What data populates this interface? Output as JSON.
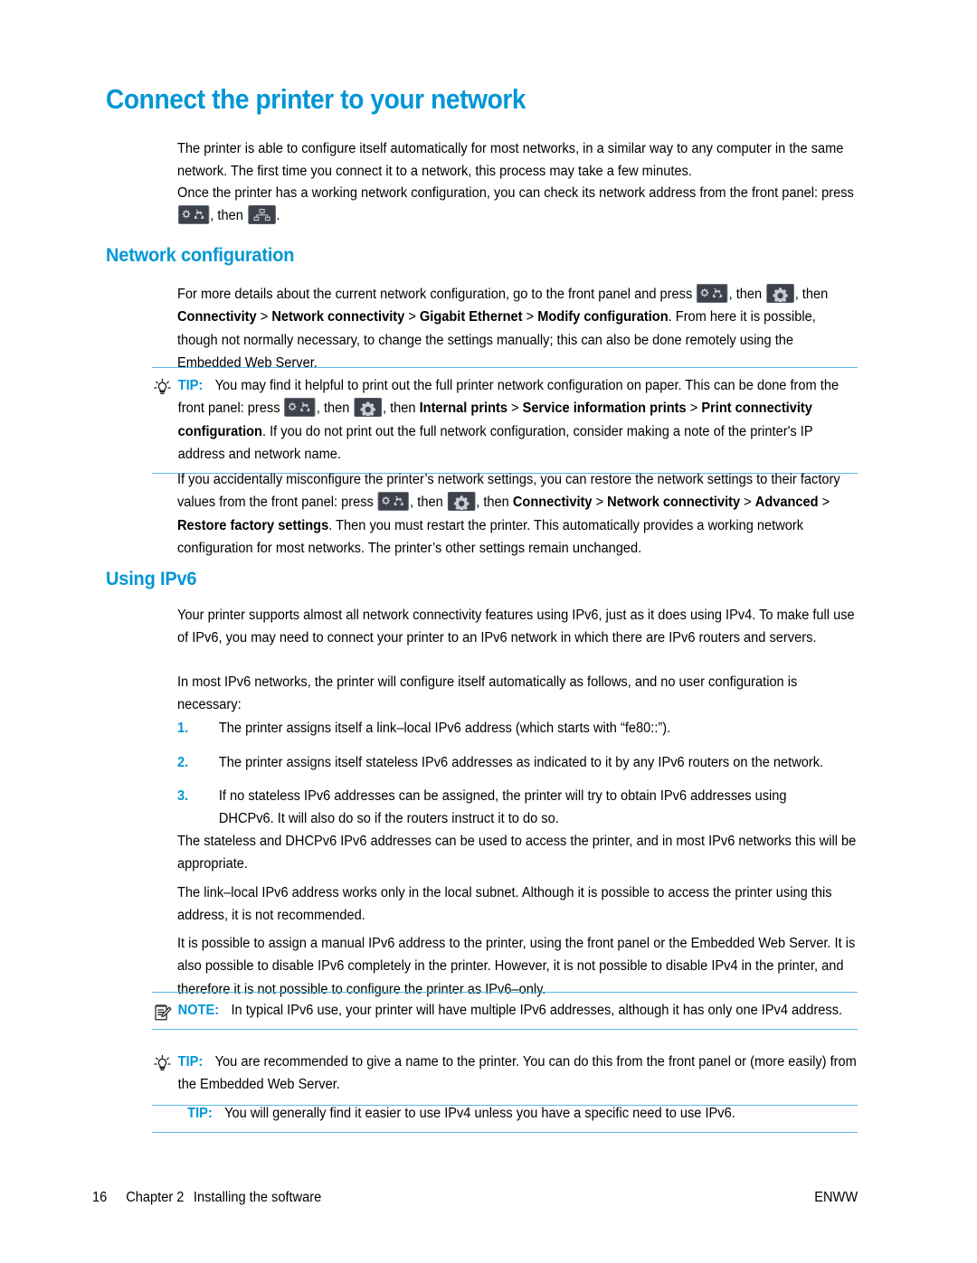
{
  "page": {
    "heading": "Connect the printer to your network",
    "accent_color": "#0096d6",
    "rule_color": "#5bb9e8"
  },
  "intro": {
    "para1": "The printer is able to configure itself automatically for most networks, in a similar way to any computer in the same network. The first time you connect it to a network, this process may take a few minutes.",
    "para2_a": "Once the printer has a working network configuration, you can check its network address from the front panel: press ",
    "para2_b": ", then ",
    "para2_c": "."
  },
  "network_configuration": {
    "heading": "Network configuration",
    "para_a": "For more details about the current network configuration, go to the front panel and press ",
    "para_b": ", then ",
    "para_c": ", then ",
    "bold1": "Connectivity",
    "sep1": " > ",
    "bold2": "Network connectivity",
    "sep2": " > ",
    "bold3": "Gigabit Ethernet",
    "sep3": " > ",
    "bold4": "Modify configuration",
    "para_d": ". From here it is possible, though not normally necessary, to change the settings manually; this can also be done remotely using the Embedded Web Server.",
    "tip": {
      "label": "TIP:",
      "icon": "lightbulb-icon",
      "text_a": "You may find it helpful to print out the full printer network configuration on paper. This can be done from the front panel: press ",
      "text_b": ", then ",
      "text_c": ", then ",
      "bold1": "Internal prints",
      "sep1": " > ",
      "bold2": "Service information prints",
      "sep2": " > ",
      "bold3": "Print connectivity configuration",
      "text_d": ". If you do not print out the full network configuration, consider making a note of the printer's IP address and network name."
    },
    "restore_a": "If you accidentally misconfigure the printer’s network settings, you can restore the network settings to their factory values from the front panel: press ",
    "restore_b": ", then ",
    "restore_c": ", then ",
    "restore_bold1": "Connectivity",
    "restore_sep1": " > ",
    "restore_bold2": "Network connectivity",
    "restore_sep2": " > ",
    "restore_bold3": "Advanced",
    "restore_sep3": " > ",
    "restore_bold4": "Restore factory settings",
    "restore_d": ". Then you must restart the printer. This automatically provides a working network configuration for most networks. The printer’s other settings remain unchanged."
  },
  "using_ipv6": {
    "heading": "Using IPv6",
    "para1": "Your printer supports almost all network connectivity features using IPv6, just as it does using IPv4. To make full use of IPv6, you may need to connect your printer to an IPv6 network in which there are IPv6 routers and servers.",
    "para2": "In most IPv6 networks, the printer will configure itself automatically as follows, and no user configuration is necessary:",
    "steps": [
      {
        "num": "1.",
        "text": "The printer assigns itself a link–local IPv6 address (which starts with “fe80::”)."
      },
      {
        "num": "2.",
        "text": "The printer assigns itself stateless IPv6 addresses as indicated to it by any IPv6 routers on the network."
      },
      {
        "num": "3.",
        "text": "If no stateless IPv6 addresses can be assigned, the printer will try to obtain IPv6 addresses using DHCPv6. It will also do so if the routers instruct it to do so."
      }
    ],
    "para3": "The stateless and DHCPv6 IPv6 addresses can be used to access the printer, and in most IPv6 networks this will be appropriate.",
    "para4": "The link–local IPv6 address works only in the local subnet. Although it is possible to access the printer using this address, it is not recommended.",
    "para5": "It is possible to assign a manual IPv6 address to the printer, using the front panel or the Embedded Web Server. It is also possible to disable IPv6 completely in the printer. However, it is not possible to disable IPv4 in the printer, and therefore it is not possible to configure the printer as IPv6–only.",
    "note": {
      "label": "NOTE:",
      "icon": "notepad-icon",
      "text": "In typical IPv6 use, your printer will have multiple IPv6 addresses, although it has only one IPv4 address."
    },
    "tip1": {
      "label": "TIP:",
      "icon": "lightbulb-icon",
      "text": "You are recommended to give a name to the printer. You can do this from the front panel or (more easily) from the Embedded Web Server."
    },
    "tip2": {
      "label": "TIP:",
      "text": "You will generally find it easier to use IPv4 unless you have a specific need to use IPv6."
    }
  },
  "icons": {
    "gear_pair": "settings-gears-icon",
    "network": "network-tree-icon",
    "gear_single": "gear-icon"
  },
  "footer": {
    "page_number": "16",
    "chapter": "Chapter 2",
    "chapter_title": "Installing the software",
    "locale": "ENWW"
  }
}
